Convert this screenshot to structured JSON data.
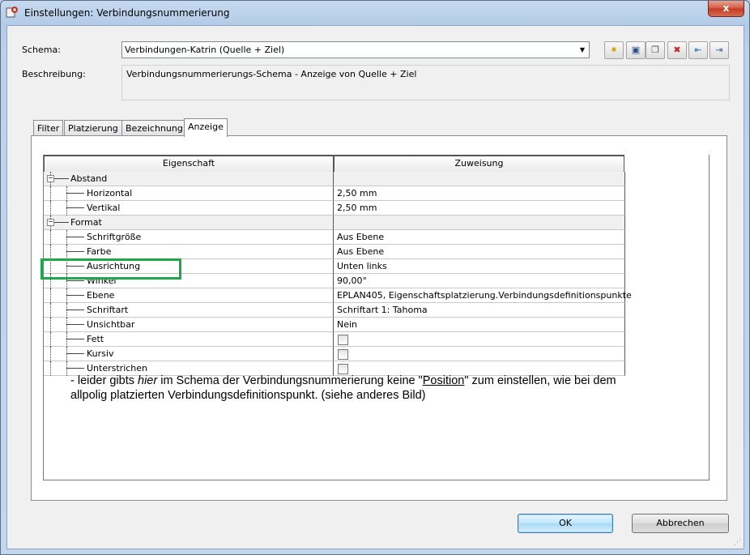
{
  "window": {
    "title": "Einstellungen: Verbindungsnummerierung",
    "close_glyph": "x"
  },
  "schema": {
    "label": "Schema:",
    "value": "Verbindungen-Katrin (Quelle + Ziel)"
  },
  "beschreibung": {
    "label": "Beschreibung:",
    "value": "Verbindungsnummerierungs-Schema - Anzeige von Quelle + Ziel"
  },
  "toolbar": {
    "buttons": [
      {
        "icon": "new-icon",
        "glyph": "✷"
      },
      {
        "icon": "save-icon",
        "glyph": "▣"
      },
      {
        "icon": "copy-icon",
        "glyph": "❐"
      },
      {
        "icon": "delete-icon",
        "glyph": "✖"
      },
      {
        "icon": "import-icon",
        "glyph": "⇤"
      },
      {
        "icon": "export-icon",
        "glyph": "⇥"
      }
    ]
  },
  "tabs": [
    {
      "label": "Filter"
    },
    {
      "label": "Platzierung"
    },
    {
      "label": "Bezeichnung"
    },
    {
      "label": "Anzeige",
      "active": true
    }
  ],
  "grid": {
    "headers": [
      "Eigenschaft",
      "Zuweisung"
    ],
    "rows": [
      {
        "name": "Abstand",
        "value": "",
        "level": 0,
        "group": true
      },
      {
        "name": "Horizontal",
        "value": "2,50 mm",
        "level": 1
      },
      {
        "name": "Vertikal",
        "value": "2,50 mm",
        "level": 1
      },
      {
        "name": "Format",
        "value": "",
        "level": 0,
        "group": true
      },
      {
        "name": "Schriftgröße",
        "value": "Aus Ebene",
        "level": 1
      },
      {
        "name": "Farbe",
        "value": "Aus Ebene",
        "level": 1
      },
      {
        "name": "Ausrichtung",
        "value": "Unten links",
        "level": 1
      },
      {
        "name": "Winkel",
        "value": "90,00°",
        "level": 1
      },
      {
        "name": "Ebene",
        "value": "EPLAN405, Eigenschaftsplatzierung.Verbindungsdefinitionspunkte",
        "level": 1
      },
      {
        "name": "Schriftart",
        "value": "Schriftart 1: Tahoma",
        "level": 1
      },
      {
        "name": "Unsichtbar",
        "value": "Nein",
        "level": 1
      },
      {
        "name": "Fett",
        "value": "",
        "level": 1,
        "checkbox": true,
        "checked": false
      },
      {
        "name": "Kursiv",
        "value": "",
        "level": 1,
        "checkbox": true,
        "checked": false
      },
      {
        "name": "Unterstrichen",
        "value": "",
        "level": 1,
        "checkbox": true,
        "checked": false
      }
    ]
  },
  "note": {
    "part1": "- leider gibts ",
    "italic": "hier",
    "part2": " im Schema der Verbindungsnummerierung keine \"",
    "underlined": "Position",
    "part3": "\" zum einstellen, wie bei dem allpolig platzierten Verbindungsdefinitionspunkt. (siehe anderes Bild)"
  },
  "buttons": {
    "ok": "OK",
    "cancel": "Abbrechen"
  },
  "colors": {
    "highlight_box": "#1fa84a"
  }
}
